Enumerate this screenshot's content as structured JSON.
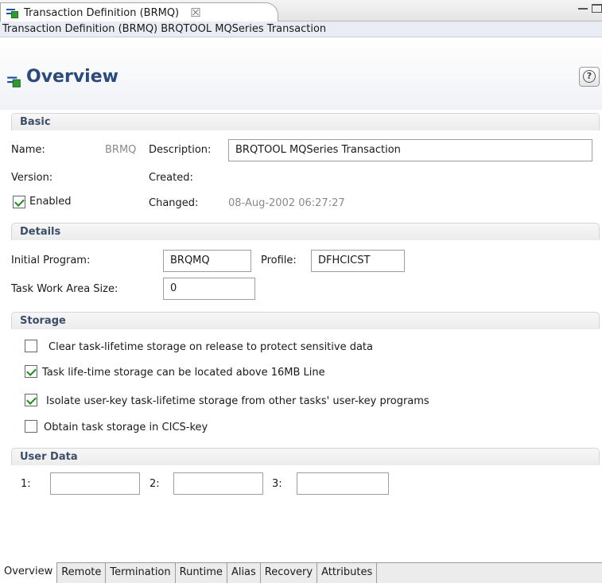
{
  "editor": {
    "tab_title": "Transaction Definition (BRMQ)",
    "close_symbol": "☒",
    "title_line": "Transaction Definition (BRMQ) BRQTOOL MQSeries Transaction",
    "overview_title": "Overview",
    "help_symbol": "?"
  },
  "basic": {
    "heading": "Basic",
    "name_label": "Name:",
    "name_value": "BRMQ",
    "description_label": "Description:",
    "description_value": "BRQTOOL MQSeries Transaction",
    "version_label": "Version:",
    "created_label": "Created:",
    "enabled_label": "Enabled",
    "enabled_checked": true,
    "changed_label": "Changed:",
    "changed_value": "08-Aug-2002 06:27:27"
  },
  "details": {
    "heading": "Details",
    "initial_program_label": "Initial Program:",
    "initial_program_value": "BRQMQ",
    "profile_label": "Profile:",
    "profile_value": "DFHCICST",
    "twa_label": "Task Work Area Size:",
    "twa_value": "0"
  },
  "storage": {
    "heading": "Storage",
    "options": [
      {
        "label": "Clear task-lifetime storage on release to protect sensitive data",
        "checked": false
      },
      {
        "label": "Task life-time storage can be located above 16MB Line",
        "checked": true
      },
      {
        "label": "Isolate user-key task-lifetime storage from other tasks' user-key programs",
        "checked": true
      },
      {
        "label": "Obtain task storage in CICS-key",
        "checked": false
      }
    ]
  },
  "user_data": {
    "heading": "User Data",
    "label_1": "1:",
    "label_2": "2:",
    "label_3": "3:",
    "value_1": "",
    "value_2": "",
    "value_3": ""
  },
  "bottom_tabs": [
    "Overview",
    "Remote",
    "Termination",
    "Runtime",
    "Alias",
    "Recovery",
    "Attributes"
  ],
  "colors": {
    "heading_text": "#3c4e6a",
    "title_text": "#2b4a7a",
    "check": "#1d8a1d"
  }
}
